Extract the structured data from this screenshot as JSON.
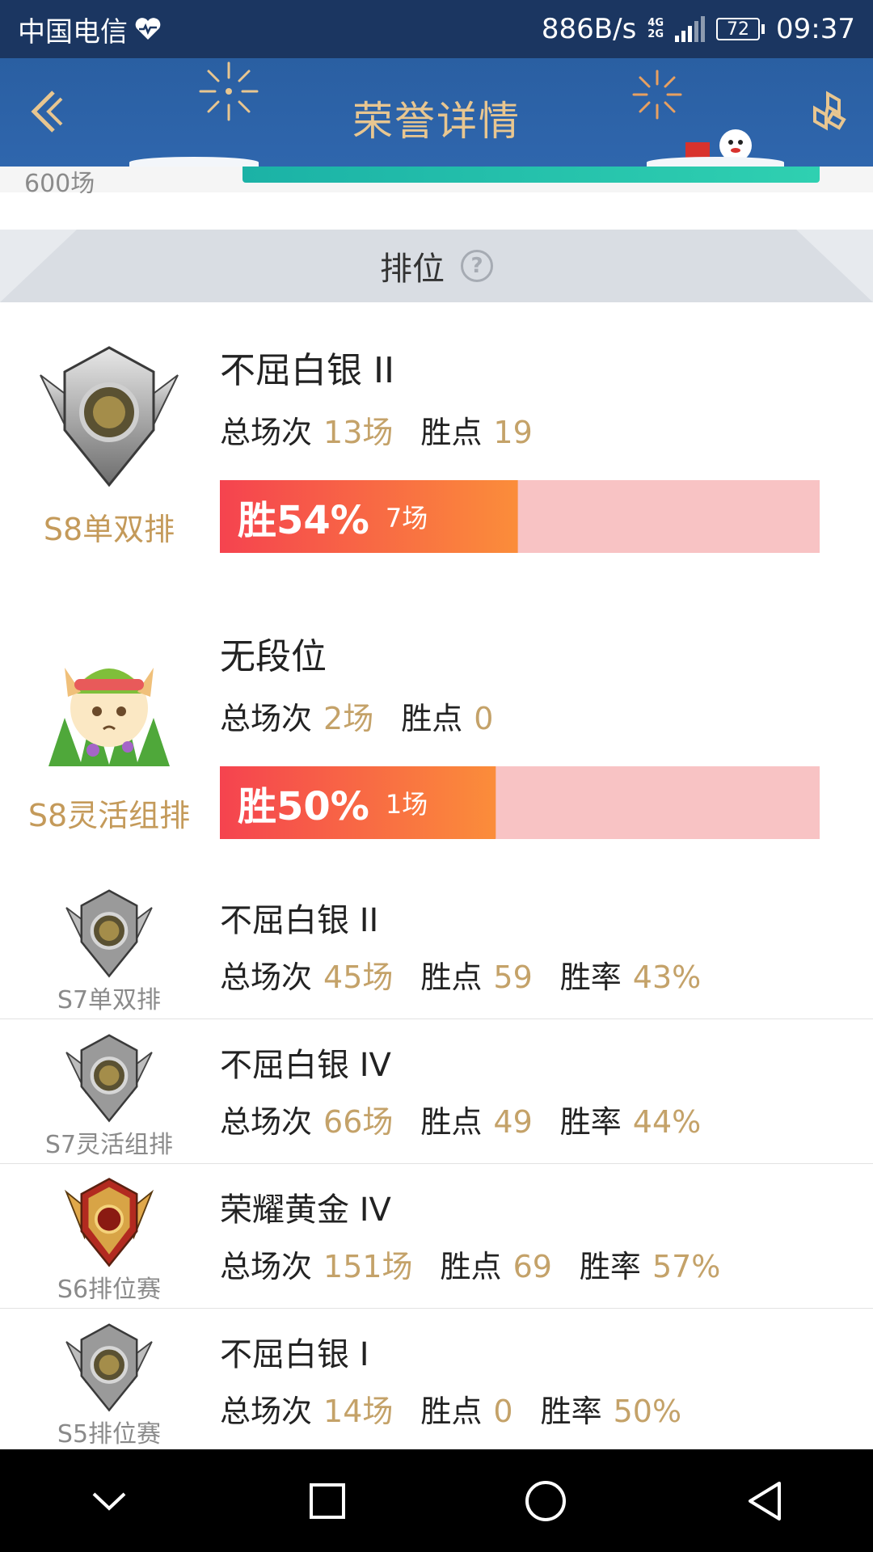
{
  "status_bar": {
    "carrier": "中国电信",
    "net_speed": "886B/s",
    "net_tags": [
      "4G",
      "2G"
    ],
    "battery": "72",
    "time": "09:37"
  },
  "header": {
    "title": "荣誉详情"
  },
  "prev_section": {
    "label": "600场",
    "bar_fill": 1.0
  },
  "section": {
    "label": "排位",
    "help": "?"
  },
  "big_entries": [
    {
      "season": "S8单双排",
      "rank": "不屈白银 II",
      "total_label": "总场次",
      "total_value": "13场",
      "points_label": "胜点",
      "points_value": "19",
      "win_pct": "胜54%",
      "win_count": "7场",
      "win_fraction": 0.54,
      "badge": "silver-badge-icon"
    },
    {
      "season": "S8灵活组排",
      "rank": "无段位",
      "total_label": "总场次",
      "total_value": "2场",
      "points_label": "胜点",
      "points_value": "0",
      "win_pct": "胜50%",
      "win_count": "1场",
      "win_fraction": 0.5,
      "badge": "teemo-avatar-icon"
    }
  ],
  "small_entries": [
    {
      "season": "S7单双排",
      "rank": "不屈白银 II",
      "total_label": "总场次",
      "total_value": "45场",
      "points_label": "胜点",
      "points_value": "59",
      "rate_label": "胜率",
      "rate_value": "43%",
      "badge": "silver-badge-icon"
    },
    {
      "season": "S7灵活组排",
      "rank": "不屈白银 IV",
      "total_label": "总场次",
      "total_value": "66场",
      "points_label": "胜点",
      "points_value": "49",
      "rate_label": "胜率",
      "rate_value": "44%",
      "badge": "silver-badge-icon"
    },
    {
      "season": "S6排位赛",
      "rank": "荣耀黄金 IV",
      "total_label": "总场次",
      "total_value": "151场",
      "points_label": "胜点",
      "points_value": "69",
      "rate_label": "胜率",
      "rate_value": "57%",
      "badge": "gold-badge-icon"
    },
    {
      "season": "S5排位赛",
      "rank": "不屈白银 I",
      "total_label": "总场次",
      "total_value": "14场",
      "points_label": "胜点",
      "points_value": "0",
      "rate_label": "胜率",
      "rate_value": "50%",
      "badge": "silver-badge-icon"
    }
  ],
  "colors": {
    "status_bg": "#1b3661",
    "header_bg": "#2f66ad",
    "title_gold": "#e8c690",
    "value_gold": "#c4a269",
    "win_red": "#f5434f",
    "win_orange": "#fb8d3a",
    "loss_pink": "#f8c3c4"
  }
}
